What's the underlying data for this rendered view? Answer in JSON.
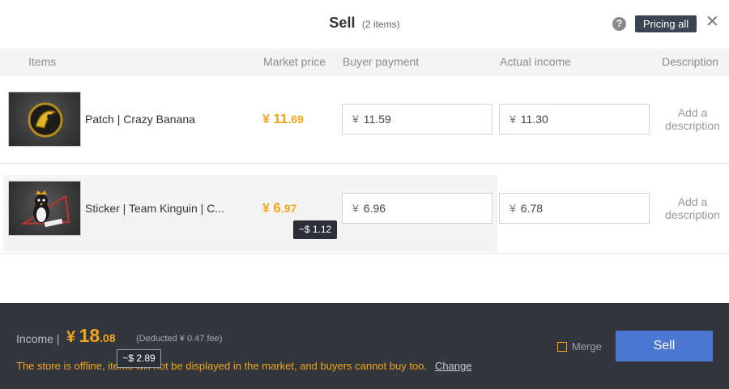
{
  "header": {
    "title": "Sell",
    "count": "(2 items)",
    "help_icon": "?",
    "pricing_all": "Pricing all",
    "close_icon": "✕"
  },
  "columns": {
    "items": "Items",
    "market_price": "Market price",
    "buyer_payment": "Buyer payment",
    "actual_income": "Actual income",
    "description": "Description"
  },
  "rows": [
    {
      "name": "Patch | Crazy Banana",
      "price_currency": "¥",
      "price_int": "11",
      "price_dec": ".69",
      "buyer_payment": "11.59",
      "actual_income": "11.30",
      "description_line1": "Add a",
      "description_line2": "description",
      "icon": "banana-patch-icon"
    },
    {
      "name": "Sticker | Team Kinguin | C...",
      "price_currency": "¥",
      "price_int": "6",
      "price_dec": ".97",
      "usd_tooltip": "~$ 1.12",
      "buyer_payment": "6.96",
      "actual_income": "6.78",
      "description_line1": "Add a",
      "description_line2": "description",
      "icon": "penguin-sticker-icon"
    }
  ],
  "currency_symbol": "¥",
  "footer": {
    "income_label": "Income |",
    "income_currency": "¥",
    "income_int": "18",
    "income_dec": ".08",
    "fee": "(Deducted ¥ 0.47 fee)",
    "usd_tooltip": "~$ 2.89",
    "offline_message": "The store is offline, items will not be displayed in the market, and buyers cannot buy too.",
    "change_label": "Change",
    "merge_label": "Merge",
    "sell_label": "Sell"
  },
  "colors": {
    "accent_price": "#f0a51a",
    "sell_button": "#4b77d1",
    "footer_bg": "#33363c",
    "pricing_button": "#3b4452"
  }
}
